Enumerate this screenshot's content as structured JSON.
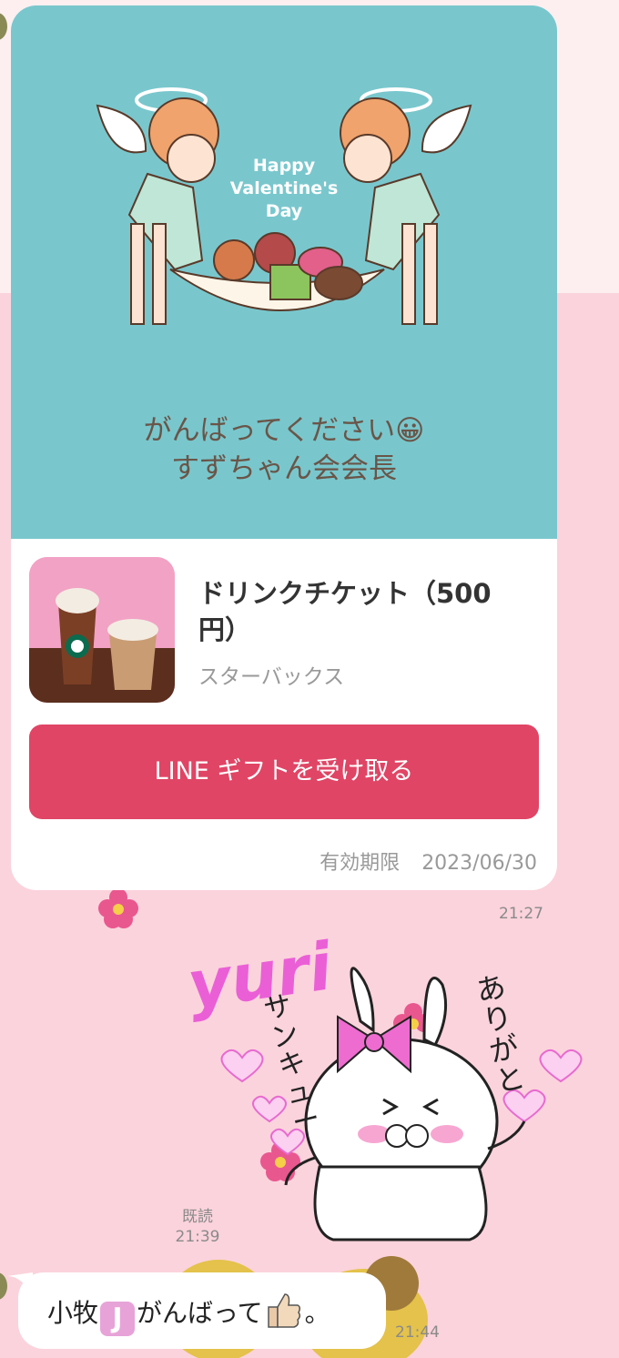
{
  "gift_card": {
    "banner_text": "Happy Valentine's Day",
    "message_line1": "がんばってください😀",
    "message_line2": "すずちゃん会会長",
    "product_name": "ドリンクチケット（500円）",
    "brand": "スターバックス",
    "receive_button": "LINE ギフトを受け取る",
    "expiry_label": "有効期限",
    "expiry_date": "2023/06/30"
  },
  "timestamps": {
    "gift": "21:27",
    "sticker_read": "既読",
    "sticker": "21:39",
    "reply": "21:44"
  },
  "sticker": {
    "word_yuri": "yuri",
    "word_thanks_left": "サンキュー",
    "word_thanks_right": "ありがと"
  },
  "reply_message": {
    "text_before": "小牧",
    "badge": "J",
    "text_after": "がんばって",
    "text_end": "。"
  },
  "colors": {
    "chat_bg": "#fbd3dc",
    "banner_bg": "#79c7cd",
    "button": "#e04565"
  }
}
